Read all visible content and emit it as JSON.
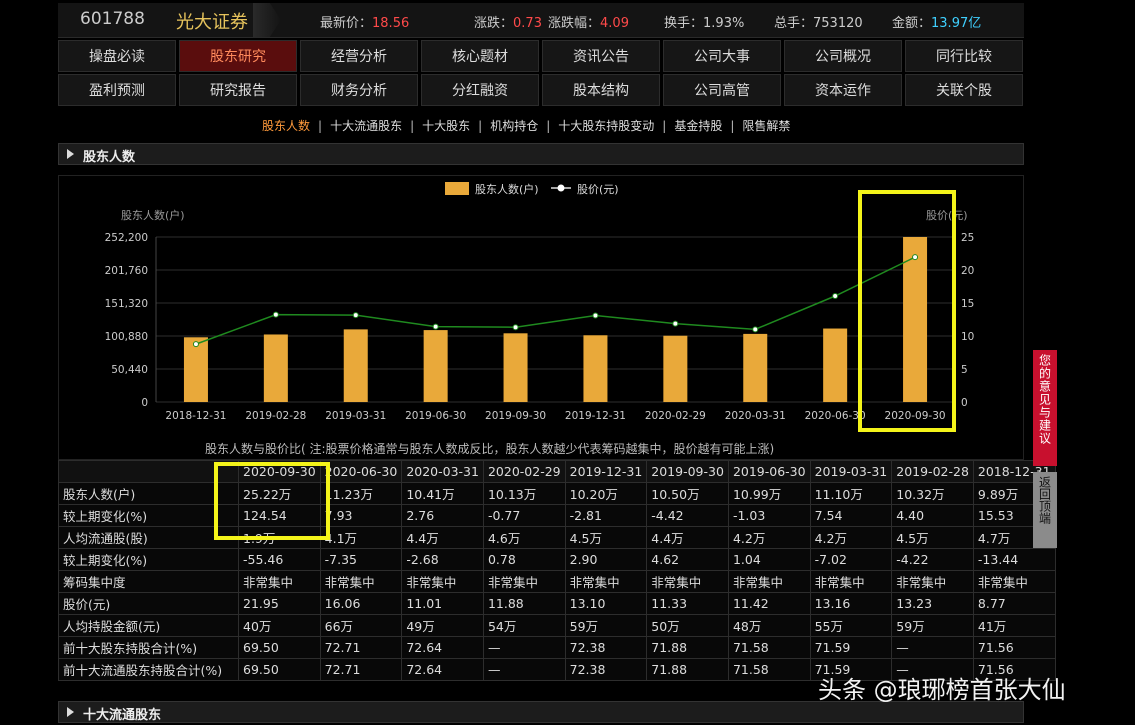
{
  "header": {
    "code": "601788",
    "name": "光大证券",
    "quotes": [
      {
        "label": "最新价：",
        "value": "18.56",
        "color": "red"
      },
      {
        "label": "涨跌：",
        "value": "0.73",
        "color": "red"
      },
      {
        "label": "涨跌幅：",
        "value": "4.09",
        "color": "red"
      },
      {
        "label": "换手：",
        "value": "1.93%",
        "color": "plain"
      },
      {
        "label": "总手：",
        "value": "753120",
        "color": "plain"
      },
      {
        "label": "金额：",
        "value": "13.97亿",
        "color": "cyan"
      }
    ]
  },
  "nav": {
    "row1": [
      "操盘必读",
      "股东研究",
      "经营分析",
      "核心题材",
      "资讯公告",
      "公司大事",
      "公司概况",
      "同行比较"
    ],
    "row2": [
      "盈利预测",
      "研究报告",
      "财务分析",
      "分红融资",
      "股本结构",
      "公司高管",
      "资本运作",
      "关联个股"
    ],
    "active": "股东研究"
  },
  "subnav": {
    "items": [
      "股东人数",
      "十大流通股东",
      "十大股东",
      "机构持仓",
      "十大股东持股变动",
      "基金持股",
      "限售解禁"
    ],
    "active": "股东人数"
  },
  "section1": "股东人数",
  "section2": "十大流通股东",
  "chart_data": {
    "type": "bar",
    "categories": [
      "2018-12-31",
      "2019-02-28",
      "2019-03-31",
      "2019-06-30",
      "2019-09-30",
      "2019-12-31",
      "2020-02-29",
      "2020-03-31",
      "2020-06-30",
      "2020-09-30"
    ],
    "series": [
      {
        "name": "股东人数(户)",
        "type": "bar",
        "values": [
          98900,
          103200,
          111000,
          109900,
          105000,
          102000,
          101300,
          104100,
          112300,
          252200
        ]
      },
      {
        "name": "股价(元)",
        "type": "line",
        "values": [
          8.77,
          13.23,
          13.16,
          11.42,
          11.33,
          13.1,
          11.88,
          11.01,
          16.06,
          21.95
        ]
      }
    ],
    "ylabel": "股东人数(户)",
    "y2label": "股价(元)",
    "ylim": [
      0,
      252200
    ],
    "yticks": [
      "0",
      "50,440",
      "100,880",
      "151,320",
      "201,760",
      "252,200"
    ],
    "y2lim": [
      0,
      25
    ],
    "y2ticks": [
      "0",
      "5",
      "10",
      "15",
      "20",
      "25"
    ],
    "legend": "top-center",
    "bar_color": "#e9a93a",
    "line_color": "#1f8a1f",
    "caption": "股东人数与股价比( 注:股票价格通常与股东人数成反比，股东人数越少代表筹码越集中，股价越有可能上涨)"
  },
  "table": {
    "headers": [
      "2020-09-30",
      "2020-06-30",
      "2020-03-31",
      "2020-02-29",
      "2019-12-31",
      "2019-09-30",
      "2019-06-30",
      "2019-03-31",
      "2019-02-28",
      "2018-12-31"
    ],
    "rows": [
      {
        "label": "股东人数(户)",
        "cells": [
          "25.22万",
          "11.23万",
          "10.41万",
          "10.13万",
          "10.20万",
          "10.50万",
          "10.99万",
          "11.10万",
          "10.32万",
          "9.89万"
        ]
      },
      {
        "label": "较上期变化(%)",
        "cells": [
          "124.54",
          "7.93",
          "2.76",
          "-0.77",
          "-2.81",
          "-4.42",
          "-1.03",
          "7.54",
          "4.40",
          "15.53"
        ]
      },
      {
        "label": "人均流通股(股)",
        "cells": [
          "1.9万",
          "4.1万",
          "4.4万",
          "4.6万",
          "4.5万",
          "4.4万",
          "4.2万",
          "4.2万",
          "4.5万",
          "4.7万"
        ]
      },
      {
        "label": "较上期变化(%)",
        "cells": [
          "-55.46",
          "-7.35",
          "-2.68",
          "0.78",
          "2.90",
          "4.62",
          "1.04",
          "-7.02",
          "-4.22",
          "-13.44"
        ]
      },
      {
        "label": "筹码集中度",
        "cells": [
          "非常集中",
          "非常集中",
          "非常集中",
          "非常集中",
          "非常集中",
          "非常集中",
          "非常集中",
          "非常集中",
          "非常集中",
          "非常集中"
        ]
      },
      {
        "label": "股价(元)",
        "cells": [
          "21.95",
          "16.06",
          "11.01",
          "11.88",
          "13.10",
          "11.33",
          "11.42",
          "13.16",
          "13.23",
          "8.77"
        ]
      },
      {
        "label": "人均持股金额(元)",
        "cells": [
          "40万",
          "66万",
          "49万",
          "54万",
          "59万",
          "50万",
          "48万",
          "55万",
          "59万",
          "41万"
        ]
      },
      {
        "label": "前十大股东持股合计(%)",
        "cells": [
          "69.50",
          "72.71",
          "72.64",
          "—",
          "72.38",
          "71.88",
          "71.58",
          "71.59",
          "—",
          "71.56"
        ]
      },
      {
        "label": "前十大流通股东持股合计(%)",
        "cells": [
          "69.50",
          "72.71",
          "72.64",
          "—",
          "72.38",
          "71.88",
          "71.58",
          "71.59",
          "—",
          "71.56"
        ]
      }
    ]
  },
  "side": {
    "feedback": "您的意见与建议",
    "totop": "返回顶端"
  },
  "watermark": "头条 @琅琊榜首张大仙"
}
